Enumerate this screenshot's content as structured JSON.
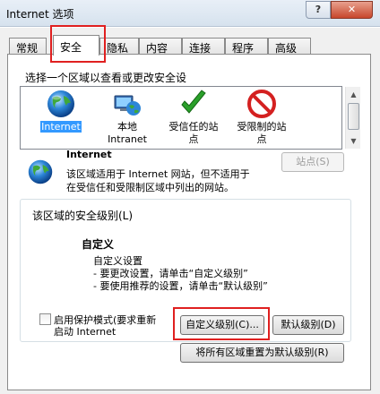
{
  "window": {
    "title": "Internet 选项",
    "help_label": "?",
    "close_label": "✕"
  },
  "tabs": [
    {
      "label": "常规"
    },
    {
      "label": "安全"
    },
    {
      "label": "隐私"
    },
    {
      "label": "内容"
    },
    {
      "label": "连接"
    },
    {
      "label": "程序"
    },
    {
      "label": "高级"
    }
  ],
  "active_tab": "安全",
  "security": {
    "zone_prompt": "选择一个区域以查看或更改安全设",
    "zones": [
      {
        "line1": "Internet",
        "line2": "",
        "icon": "globe-icon",
        "selected": true
      },
      {
        "line1": "本地",
        "line2": "Intranet",
        "icon": "local-intranet-icon",
        "selected": false
      },
      {
        "line1": "受信任的站",
        "line2": "点",
        "icon": "trusted-sites-check-icon",
        "selected": false
      },
      {
        "line1": "受限制的站",
        "line2": "点",
        "icon": "restricted-sites-icon",
        "selected": false
      }
    ],
    "zone_info": {
      "name": "Internet",
      "desc_line1": "该区域适用于 Internet 网站，但不适用于",
      "desc_line2": "在受信任和受限制区域中列出的网站。",
      "sites_button": "站点(S)"
    },
    "level_group": {
      "legend": "该区域的安全级别(L)",
      "level_name": "自定义",
      "line1": "自定义设置",
      "line2": "- 要更改设置，请单击“自定义级别”",
      "line3": "- 要使用推荐的设置，请单击“默认级别”",
      "protected_mode_line1": "启用保护模式(要求重新",
      "protected_mode_line2": "启动 Internet",
      "protected_mode_checked": false,
      "custom_level_button": "自定义级别(C)...",
      "default_level_button": "默认级别(D)"
    },
    "reset_all_button": "将所有区域重置为默认级别(R)"
  }
}
